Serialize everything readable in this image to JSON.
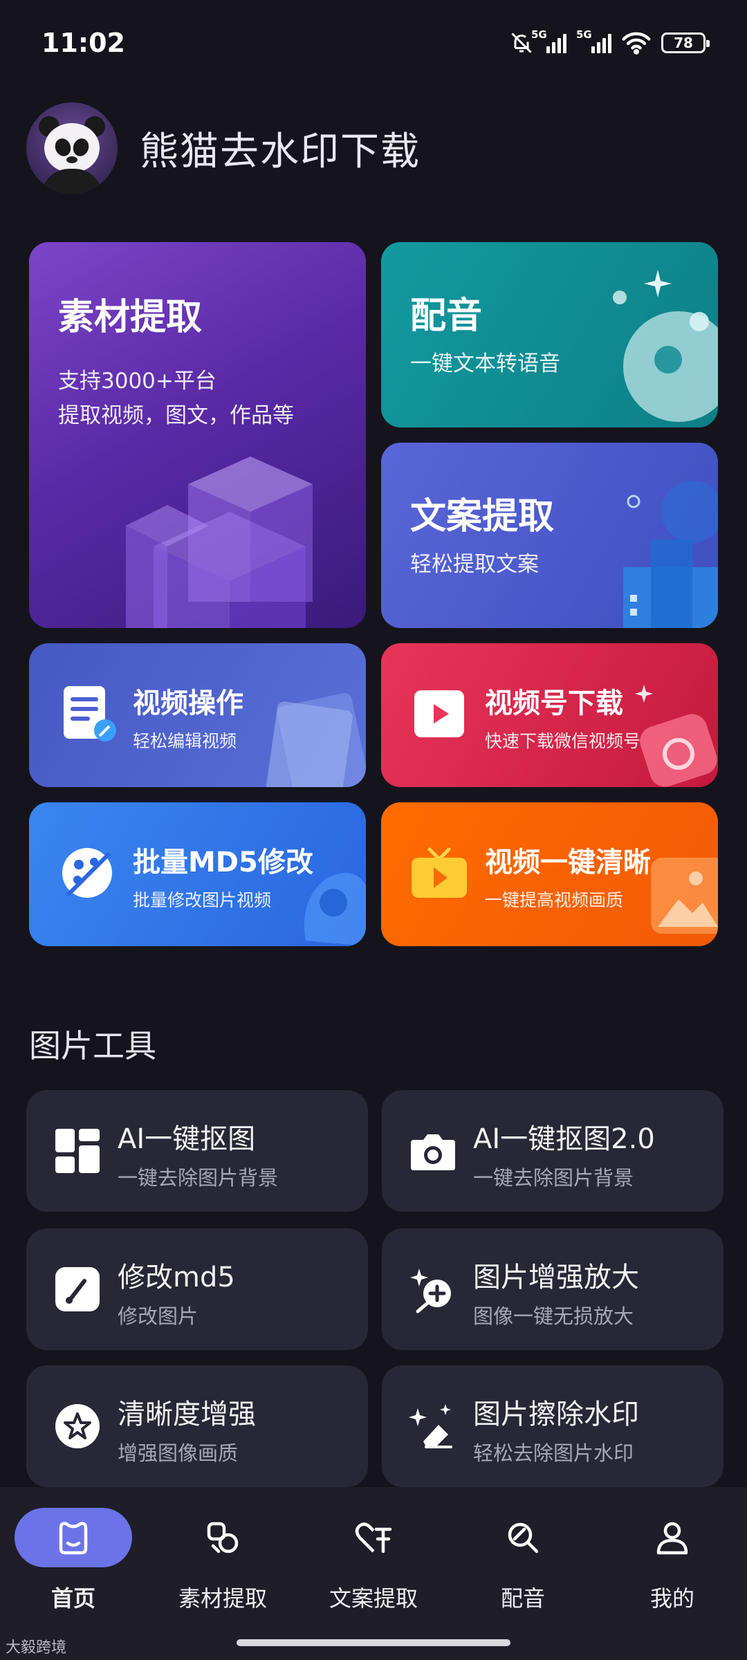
{
  "status_bar": {
    "time": "11:02",
    "network1": "5G",
    "network2": "5G",
    "battery": "78"
  },
  "header": {
    "title": "熊猫去水印下载"
  },
  "features": {
    "material": {
      "title": "素材提取",
      "subtitle1": "支持3000+平台",
      "subtitle2": "提取视频，图文，作品等"
    },
    "dubbing": {
      "title": "配音",
      "subtitle": "一键文本转语音"
    },
    "copy_extract": {
      "title": "文案提取",
      "subtitle": "轻松提取文案"
    },
    "video_ops": {
      "title": "视频操作",
      "subtitle": "轻松编辑视频"
    },
    "channel_dl": {
      "title": "视频号下载",
      "subtitle": "快速下载微信视频号"
    },
    "batch_md5": {
      "title": "批量MD5修改",
      "subtitle": "批量修改图片视频"
    },
    "video_hd": {
      "title": "视频一键清晰",
      "subtitle": "一键提高视频画质"
    }
  },
  "image_tools": {
    "section_title": "图片工具",
    "items": [
      {
        "title": "AI一键抠图",
        "subtitle": "一键去除图片背景",
        "icon": "grid-icon"
      },
      {
        "title": "AI一键抠图2.0",
        "subtitle": "一键去除图片背景",
        "icon": "camera-icon"
      },
      {
        "title": "修改md5",
        "subtitle": "修改图片",
        "icon": "brush-icon"
      },
      {
        "title": "图片增强放大",
        "subtitle": "图像一键无损放大",
        "icon": "sparkle-plus-icon"
      },
      {
        "title": "清晰度增强",
        "subtitle": "增强图像画质",
        "icon": "star-badge-icon"
      },
      {
        "title": "图片擦除水印",
        "subtitle": "轻松去除图片水印",
        "icon": "eraser-sparkle-icon"
      }
    ]
  },
  "bottom_nav": {
    "items": [
      {
        "label": "首页",
        "icon": "home-bear-icon",
        "active": true
      },
      {
        "label": "素材提取",
        "icon": "shapes-icon",
        "active": false
      },
      {
        "label": "文案提取",
        "icon": "heart-text-icon",
        "active": false
      },
      {
        "label": "配音",
        "icon": "search-mic-icon",
        "active": false
      },
      {
        "label": "我的",
        "icon": "user-icon",
        "active": false
      }
    ]
  },
  "watermark": "大毅跨境",
  "colors": {
    "background": "#15141d",
    "tool_card": "#282735",
    "nav_active": "#6c73e8"
  }
}
